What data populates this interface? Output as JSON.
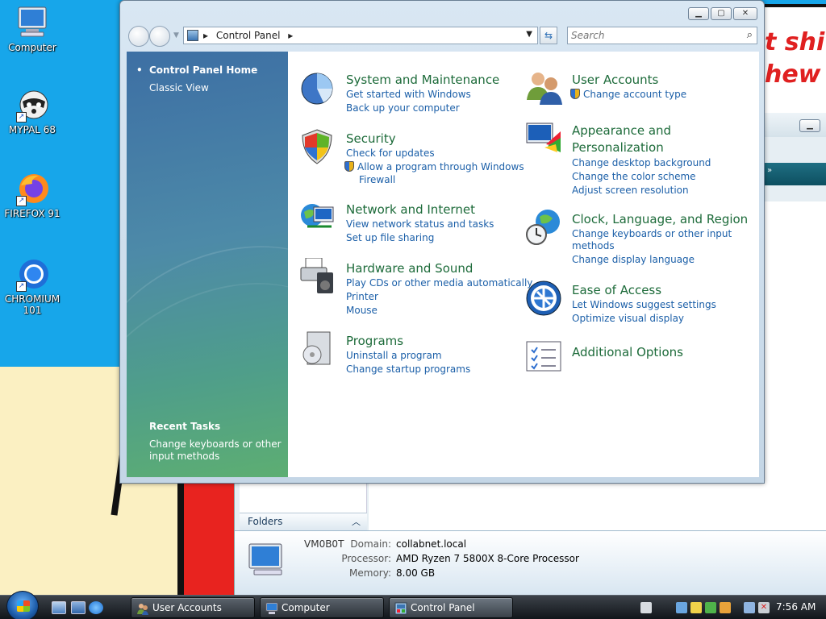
{
  "desktop": {
    "icons": [
      {
        "label": "Computer"
      },
      {
        "label": "MYPAL 68"
      },
      {
        "label": "FIREFOX 91"
      },
      {
        "label": "CHROMIUM 101"
      }
    ],
    "paint_text_line1": "t shi",
    "paint_text_line2": "hew"
  },
  "background_window": {
    "folders_label": "Folders",
    "details": {
      "computer_name": "VM0B0T",
      "domain_label": "Domain:",
      "domain_value": "collabnet.local",
      "processor_label": "Processor:",
      "processor_value": "AMD Ryzen 7 5800X 8-Core Processor",
      "memory_label": "Memory:",
      "memory_value": "8.00 GB"
    }
  },
  "control_panel": {
    "address": {
      "segment": "Control Panel"
    },
    "search": {
      "placeholder": "Search"
    },
    "left_nav": {
      "home": "Control Panel Home",
      "classic": "Classic View",
      "recent_tasks_title": "Recent Tasks",
      "recent_task_1_line1": "Change keyboards or other",
      "recent_task_1_line2": "input methods"
    },
    "categories": {
      "system": {
        "title": "System and Maintenance",
        "links": [
          "Get started with Windows",
          "Back up your computer"
        ]
      },
      "security": {
        "title": "Security",
        "links": [
          "Check for updates",
          "Allow a program through Windows",
          "Firewall"
        ]
      },
      "network": {
        "title": "Network and Internet",
        "links": [
          "View network status and tasks",
          "Set up file sharing"
        ]
      },
      "hardware": {
        "title": "Hardware and Sound",
        "links": [
          "Play CDs or other media automatically",
          "Printer",
          "Mouse"
        ]
      },
      "programs": {
        "title": "Programs",
        "links": [
          "Uninstall a program",
          "Change startup programs"
        ]
      },
      "users": {
        "title": "User Accounts",
        "links": [
          "Change account type"
        ]
      },
      "appearance": {
        "title_line1": "Appearance and",
        "title_line2": "Personalization",
        "links": [
          "Change desktop background",
          "Change the color scheme",
          "Adjust screen resolution"
        ]
      },
      "clock": {
        "title": "Clock, Language, and Region",
        "links": [
          "Change keyboards or other input",
          "methods",
          "Change display language"
        ]
      },
      "ease": {
        "title": "Ease of Access",
        "links": [
          "Let Windows suggest settings",
          "Optimize visual display"
        ]
      },
      "additional": {
        "title": "Additional Options"
      }
    }
  },
  "taskbar": {
    "buttons": [
      {
        "label": "User Accounts"
      },
      {
        "label": "Computer"
      },
      {
        "label": "Control Panel"
      }
    ],
    "clock": "7:56 AM"
  }
}
